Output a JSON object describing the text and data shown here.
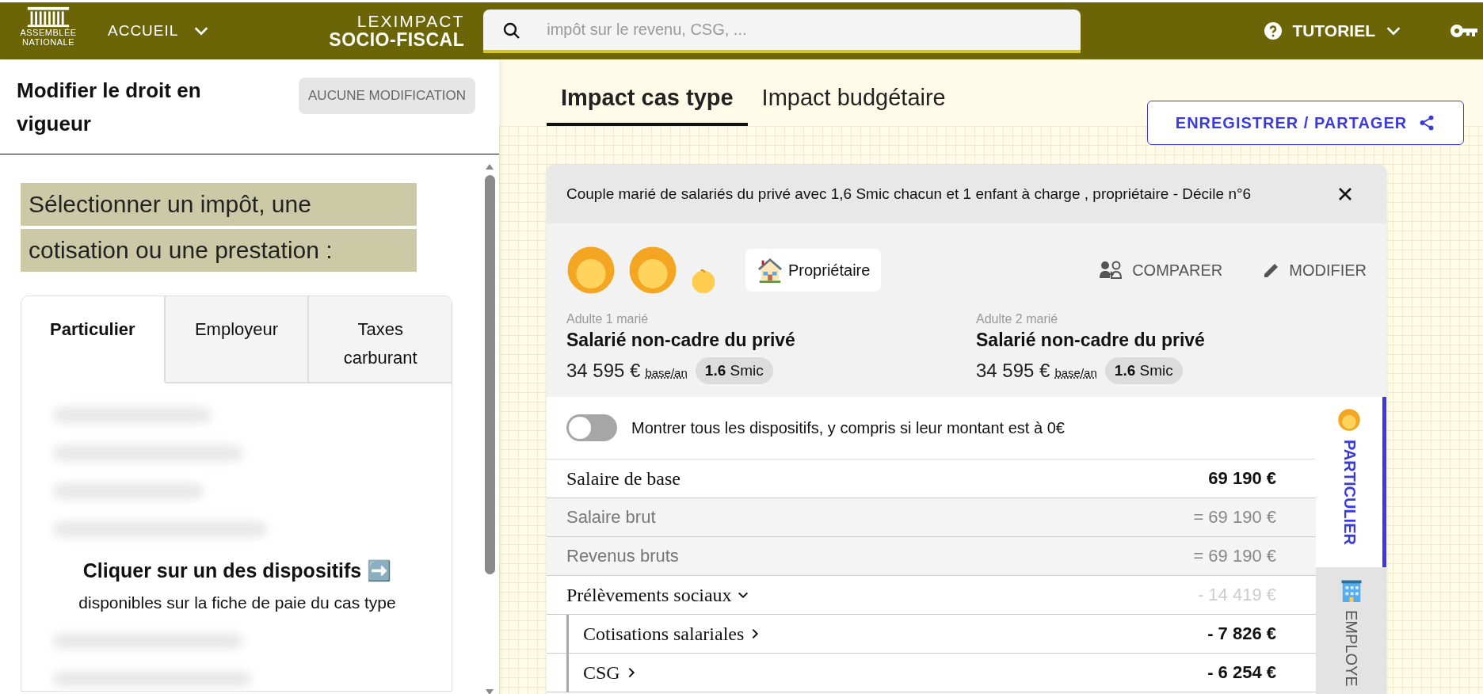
{
  "header": {
    "logo_lines": [
      "ASSEMBLÉE",
      "NATIONALE"
    ],
    "nav": {
      "label": "ACCUEIL"
    },
    "brand": {
      "line1": "LEXIMPACT",
      "line2": "SOCIO-FISCAL"
    },
    "search": {
      "placeholder": "impôt sur le revenu, CSG, ..."
    },
    "tutorial": {
      "label": "TUTORIEL"
    }
  },
  "left_panel": {
    "title": "Modifier le droit en vigueur",
    "status_button": {
      "label": "AUCUNE MODIFICATION"
    },
    "prompt_lines": [
      "Sélectionner un impôt, une",
      "cotisation ou une prestation :"
    ],
    "tabs": [
      {
        "label": "Particulier",
        "selected": true
      },
      {
        "label": "Employeur",
        "selected": false
      },
      {
        "label": "Taxes carburant",
        "selected": false
      }
    ],
    "hint": {
      "title": "Cliquer sur un des dispositifs ➡️",
      "text": "disponibles sur la fiche de paie du cas type"
    }
  },
  "main": {
    "tabs": [
      {
        "label": "Impact cas type",
        "selected": true
      },
      {
        "label": "Impact budgétaire",
        "selected": false
      }
    ],
    "save_button": {
      "label": "ENREGISTRER / PARTAGER"
    },
    "case_card": {
      "title": "Couple marié de salariés du privé avec 1,6 Smic chacun et 1 enfant à charge , propriétaire - Décile n°6",
      "members": [
        {
          "kind": "adult"
        },
        {
          "kind": "adult"
        },
        {
          "kind": "child"
        }
      ],
      "housing": "Propriétaire",
      "actions": [
        {
          "label": "COMPARER",
          "kind": "compare"
        },
        {
          "label": "MODIFIER",
          "kind": "edit"
        }
      ],
      "adults": [
        {
          "caption": "Adulte 1 marié",
          "status": "Salarié non-cadre du privé",
          "salary": "34 595 €",
          "salary_unit": "base/an",
          "smic_value": "1.6",
          "smic_unit": "Smic"
        },
        {
          "caption": "Adulte 2 marié",
          "status": "Salarié non-cadre du privé",
          "salary": "34 595 €",
          "salary_unit": "base/an",
          "smic_value": "1.6",
          "smic_unit": "Smic"
        }
      ],
      "toggle": {
        "label": "Montrer tous les dispositifs, y compris si leur montant est à 0€",
        "on": false
      },
      "rows": [
        {
          "label": "Salaire de base",
          "value": "69 190 €",
          "kind": "main"
        },
        {
          "label": "Salaire brut",
          "value": "= 69 190 €",
          "kind": "derived"
        },
        {
          "label": "Revenus bruts",
          "value": "= 69 190 €",
          "kind": "derived"
        },
        {
          "label": "Prélèvements sociaux",
          "value": "- 14 419 €",
          "kind": "group",
          "expanded": true
        },
        {
          "label": "Cotisations salariales",
          "value": "- 7 826 €",
          "kind": "sub",
          "expanded": false
        },
        {
          "label": "CSG",
          "value": "- 6 254 €",
          "kind": "sub",
          "expanded": false
        }
      ],
      "side_tabs": [
        {
          "label": "PARTICULIER",
          "kind": "person",
          "selected": true
        },
        {
          "label": "EMPLOYE",
          "kind": "building",
          "selected": false
        }
      ]
    }
  }
}
